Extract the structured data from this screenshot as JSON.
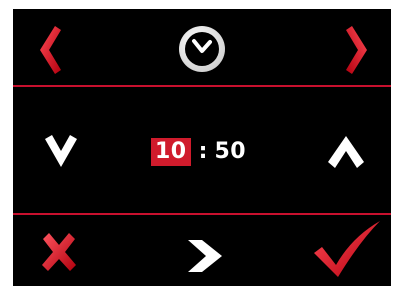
{
  "header": {
    "prev_icon": "chevron-left-icon",
    "mode_icon": "clock-icon",
    "next_icon": "chevron-right-icon"
  },
  "time_setter": {
    "hours": "10",
    "separator": ":",
    "minutes": "50",
    "selected_field": "hours",
    "decrement_icon": "chevron-down-icon",
    "increment_icon": "chevron-up-icon"
  },
  "footer": {
    "cancel_icon": "cross-icon",
    "next_field_icon": "arrow-right-icon",
    "confirm_icon": "checkmark-icon"
  },
  "colors": {
    "background": "#000000",
    "accent_red": "#c8102e",
    "highlight_red": "#d01b2c",
    "foreground": "#ffffff"
  }
}
